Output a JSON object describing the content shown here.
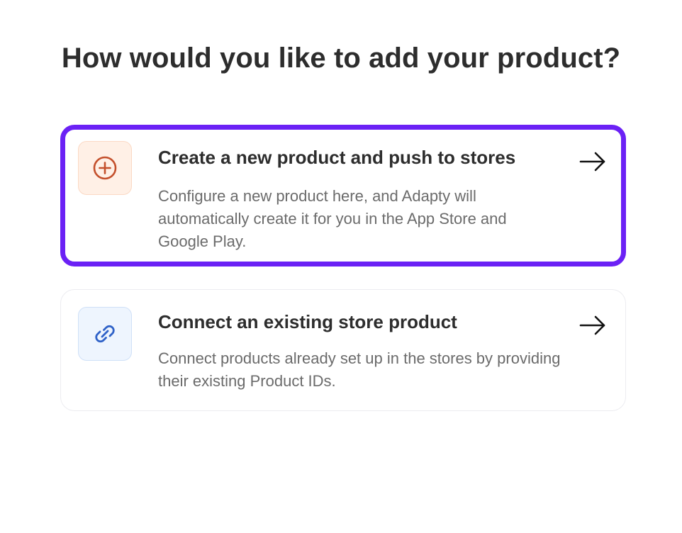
{
  "page": {
    "heading": "How would you like to add your product?"
  },
  "options": [
    {
      "title": "Create a new product and push to stores",
      "description": "Configure a new product here, and Adapty will automatically create it for you in the App Store and Google Play.",
      "icon": "plus-circle-icon",
      "icon_color": "#c4502c",
      "selected": true
    },
    {
      "title": "Connect an existing store product",
      "description": "Connect products already set up in the stores by providing their existing Product IDs.",
      "icon": "link-icon",
      "icon_color": "#2f62c8",
      "selected": false
    }
  ],
  "colors": {
    "accent": "#6b21f5",
    "text_primary": "#2d2d2d",
    "text_secondary": "#6b6b6b"
  }
}
